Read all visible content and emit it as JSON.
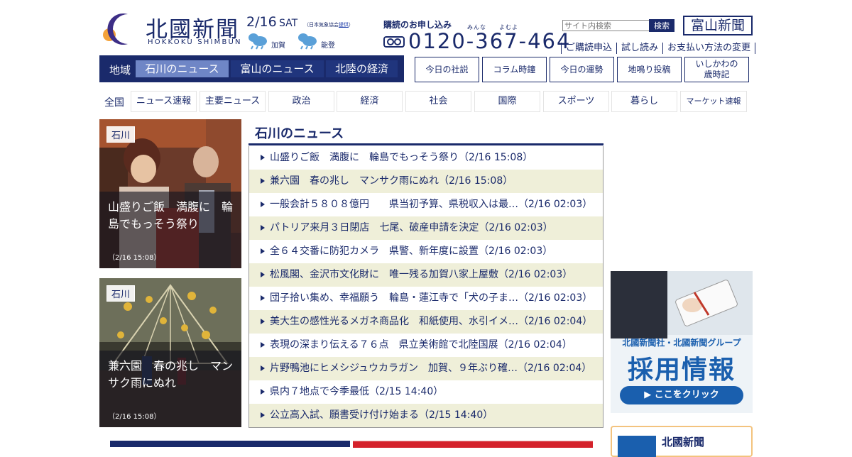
{
  "header": {
    "logo_title": "北國新聞",
    "logo_sub": "HOKKOKU SHIMBUN",
    "date": "2/16",
    "day_of_week": "SAT",
    "weather_credit_prefix": "（日本気象協会",
    "weather_credit_link": "提供",
    "weather_credit_suffix": "）",
    "weather": [
      {
        "region": "加賀",
        "icon": "cloud-rain-icon"
      },
      {
        "region": "能登",
        "icon": "cloud-rain-icon"
      }
    ],
    "subscribe_label": "購読のお申し込み",
    "phone_ruby": "みんな　　よむよ",
    "phone": "0120-367-464",
    "search_placeholder": "サイト内検索",
    "search_button": "検索",
    "toyama_link": "富山新聞",
    "top_links": [
      "ご購読申込",
      "試し読み",
      "お支払い方法の変更"
    ]
  },
  "region_nav": {
    "label": "地域",
    "tabs": [
      {
        "label": "石川のニュース",
        "active": true
      },
      {
        "label": "富山のニュース",
        "active": false
      },
      {
        "label": "北陸の経済",
        "active": false
      }
    ]
  },
  "column_buttons": [
    "今日の社説",
    "コラム時鐘",
    "今日の運勢",
    "地鳴り投稿",
    "いしかわの\n歳時記"
  ],
  "category_nav": {
    "all_label": "全国",
    "items": [
      "ニュース速報",
      "主要ニュース",
      "政治",
      "経済",
      "社会",
      "国際",
      "スポーツ",
      "暮らし",
      "マーケット速報"
    ]
  },
  "photo_cards": [
    {
      "tag": "石川",
      "title": "山盛りご飯　満腹に　輪島でもっそう祭り",
      "time": "（2/16 15:08）"
    },
    {
      "tag": "石川",
      "title": "兼六園　春の兆し　マンサク雨にぬれ",
      "time": "（2/16 15:08）"
    }
  ],
  "news": {
    "title": "石川のニュース",
    "items": [
      "山盛りご飯　満腹に　輪島でもっそう祭り（2/16 15:08）",
      "兼六園　春の兆し　マンサク雨にぬれ（2/16 15:08）",
      "一般会計５８０８億円　　県当初予算、県税収入は最…（2/16 02:03）",
      "パトリア来月３日閉店　七尾、破産申請を決定（2/16 02:03）",
      "全６４交番に防犯カメラ　県警、新年度に設置（2/16 02:03）",
      "松風閣、金沢市文化財に　唯一残る加賀八家上屋敷（2/16 02:03）",
      "団子拾い集め、幸福願う　輪島・蓮江寺で「犬の子ま…（2/16 02:03）",
      "美大生の感性光るメガネ商品化　和紙使用、水引イメ…（2/16 02:04）",
      "表現の深まり伝える７６点　県立美術館で北陸国展（2/16 02:04）",
      "片野鴨池にヒメシジュウカラガン　加賀、９年ぶり確…（2/16 02:04）",
      "県内７地点で今季最低（2/15 14:40）",
      "公立高入試、願書受け付け始まる（2/15 14:40）"
    ]
  },
  "ad": {
    "company": "北國新聞社・北國新聞グループ",
    "headline": "採用情報",
    "button": "ここをクリック"
  },
  "ad2": {
    "text": "北國新聞"
  },
  "colors": {
    "navy": "#1a2a6b",
    "active_tab": "#6f86c6",
    "alt_row": "#efefd9",
    "ad_blue": "#1a5fae"
  }
}
